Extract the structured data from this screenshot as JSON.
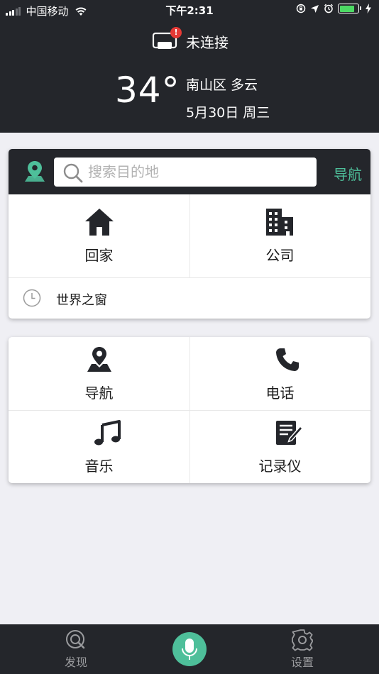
{
  "status_bar": {
    "carrier": "中国移动",
    "time": "下午2:31"
  },
  "header": {
    "connection_status": "未连接",
    "connection_badge": "!",
    "temperature": "34°",
    "location_weather": "南山区 多云",
    "date": "5月30日 周三"
  },
  "search": {
    "placeholder": "搜索目的地",
    "nav_button": "导航"
  },
  "quick_destinations": {
    "home": "回家",
    "company": "公司"
  },
  "recent": [
    {
      "label": "世界之窗"
    }
  ],
  "functions": {
    "navigation": "导航",
    "phone": "电话",
    "music": "音乐",
    "recorder": "记录仪"
  },
  "tabbar": {
    "discover": "发现",
    "settings": "设置"
  },
  "colors": {
    "accent": "#4ebf9a",
    "header_bg": "#24262b",
    "page_bg": "#efeff4",
    "badge": "#e53935",
    "battery": "#4cd964"
  },
  "battery_level": 0.8
}
